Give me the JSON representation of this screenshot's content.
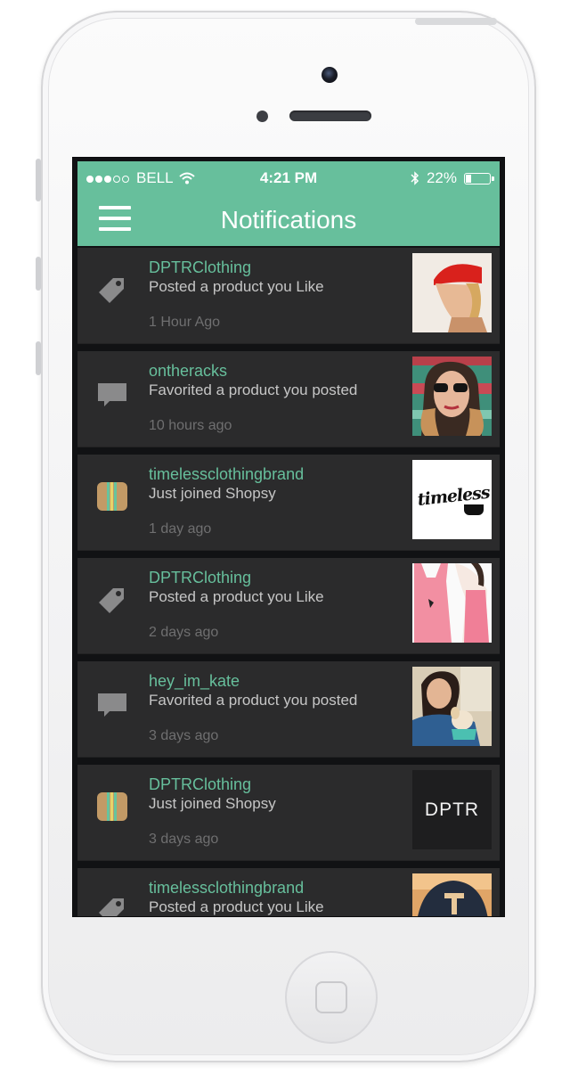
{
  "status_bar": {
    "carrier": "BELL",
    "time": "4:21 PM",
    "battery": "22%",
    "battery_level": 0.22,
    "signal_bars": 3,
    "signal_total": 5
  },
  "nav": {
    "title": "Notifications",
    "menu_icon": "hamburger-menu-icon"
  },
  "colors": {
    "accent": "#67bf9c",
    "row_bg": "#2b2b2c",
    "time_text": "#6f6f70"
  },
  "notifications": [
    {
      "user": "DPTRClothing",
      "action": "Posted a product you Like",
      "time": "1 Hour Ago",
      "icon": "price-tag-icon",
      "thumb": "red-beanie-photo"
    },
    {
      "user": "ontheracks",
      "action": "Favorited a product you posted",
      "time": "10 hours ago",
      "icon": "speech-bubble-icon",
      "thumb": "sunglasses-portrait-photo"
    },
    {
      "user": "timelessclothingbrand",
      "action": "Just joined Shopsy",
      "time": "1 day ago",
      "icon": "shopsy-app-icon",
      "thumb": "timeless-logo",
      "thumb_text": "timeless"
    },
    {
      "user": "DPTRClothing",
      "action": "Posted a product you Like",
      "time": "2 days ago",
      "icon": "price-tag-icon",
      "thumb": "pink-tank-top-photo"
    },
    {
      "user": "hey_im_kate",
      "action": "Favorited a product you posted",
      "time": "3 days ago",
      "icon": "speech-bubble-icon",
      "thumb": "girl-with-puppy-photo"
    },
    {
      "user": "DPTRClothing",
      "action": "Just joined Shopsy",
      "time": "3 days ago",
      "icon": "shopsy-app-icon",
      "thumb": "dptr-logo",
      "thumb_text": "DPTR"
    },
    {
      "user": "timelessclothingbrand",
      "action": "Posted a product you Like",
      "time": "",
      "icon": "price-tag-icon",
      "thumb": "cap-photo"
    }
  ]
}
